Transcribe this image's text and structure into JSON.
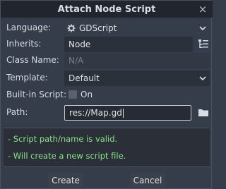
{
  "dialog": {
    "title": "Attach Node Script",
    "close_glyph": "×"
  },
  "form": {
    "language": {
      "label": "Language:",
      "value": "GDScript",
      "icon": "gdscript-icon"
    },
    "inherits": {
      "label": "Inherits:",
      "value": "Node"
    },
    "class_name": {
      "label": "Class Name:",
      "placeholder": "N/A"
    },
    "template": {
      "label": "Template:",
      "value": "Default"
    },
    "builtin": {
      "label": "Built-in Script:",
      "toggle_label": "On",
      "checked": false
    },
    "path": {
      "label": "Path:",
      "value": "res://Map.gd"
    }
  },
  "status": {
    "lines": [
      "- Script path/name is valid.",
      "- Will create a new script file."
    ],
    "color": "#8ce08c"
  },
  "buttons": {
    "create": "Create",
    "cancel": "Cancel"
  }
}
